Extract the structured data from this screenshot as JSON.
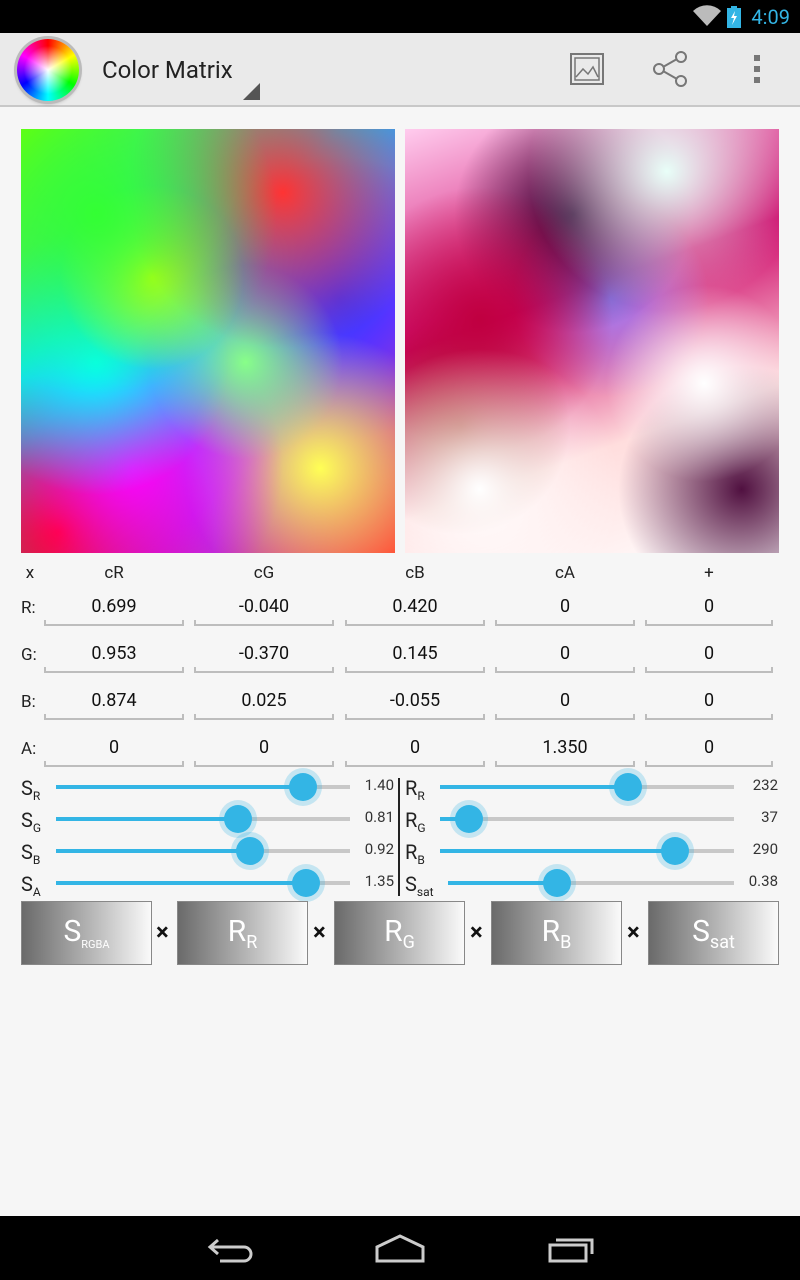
{
  "status": {
    "time": "4:09"
  },
  "actionbar": {
    "title": "Color Matrix",
    "icons": [
      "color-wheel-icon",
      "image-icon",
      "share-icon",
      "overflow-menu-icon"
    ]
  },
  "matrix": {
    "corner": "x",
    "columns": [
      "cR",
      "cG",
      "cB",
      "cA",
      "+"
    ],
    "rows": [
      {
        "label": "R:",
        "values": [
          "0.699",
          "-0.040",
          "0.420",
          "0",
          "0"
        ]
      },
      {
        "label": "G:",
        "values": [
          "0.953",
          "-0.370",
          "0.145",
          "0",
          "0"
        ]
      },
      {
        "label": "B:",
        "values": [
          "0.874",
          "0.025",
          "-0.055",
          "0",
          "0"
        ]
      },
      {
        "label": "A:",
        "values": [
          "0",
          "0",
          "0",
          "1.350",
          "0"
        ]
      }
    ]
  },
  "sliders_left": [
    {
      "name": "S",
      "sub": "R",
      "value": "1.40",
      "fraction": 0.84
    },
    {
      "name": "S",
      "sub": "G",
      "value": "0.81",
      "fraction": 0.62
    },
    {
      "name": "S",
      "sub": "B",
      "value": "0.92",
      "fraction": 0.66
    },
    {
      "name": "S",
      "sub": "A",
      "value": "1.35",
      "fraction": 0.85
    }
  ],
  "sliders_right": [
    {
      "name": "R",
      "sub": "R",
      "value": "232",
      "fraction": 0.64
    },
    {
      "name": "R",
      "sub": "G",
      "value": "37",
      "fraction": 0.1
    },
    {
      "name": "R",
      "sub": "B",
      "value": "290",
      "fraction": 0.8
    },
    {
      "name": "S",
      "sub": "sat",
      "value": "0.38",
      "fraction": 0.38
    }
  ],
  "buttons": [
    {
      "name": "S",
      "sub": "RGBA"
    },
    {
      "name": "R",
      "sub": "R"
    },
    {
      "name": "R",
      "sub": "G"
    },
    {
      "name": "R",
      "sub": "B"
    },
    {
      "name": "S",
      "sub": "sat"
    }
  ],
  "operator": "×",
  "colors": {
    "accent": "#33b5e5",
    "statusbar": "#000000",
    "actionbar": "#eaeaea"
  }
}
